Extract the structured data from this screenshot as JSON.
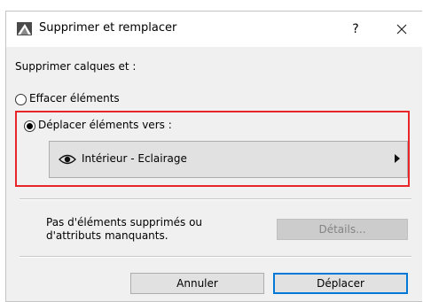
{
  "titlebar": {
    "title": "Supprimer et remplacer",
    "help_label": "?",
    "app_icon": "archicad-app-icon",
    "close_icon": "close-icon"
  },
  "main": {
    "section_label": "Supprimer calques et :",
    "option_delete": {
      "label": "Effacer éléments",
      "selected": false
    },
    "option_move": {
      "label": "Déplacer éléments vers :",
      "selected": true
    },
    "target_layer": {
      "name": "Intérieur - Eclairage",
      "icon": "eye-icon",
      "submenu_icon": "chevron-right-icon"
    },
    "info_line1": "Pas d'éléments supprimés ou",
    "info_line2": "d'attributs manquants.",
    "details_label": "Détails...",
    "highlight_color": "#e8262a"
  },
  "footer": {
    "cancel_label": "Annuler",
    "move_label": "Déplacer",
    "primary_color": "#0078d7"
  }
}
